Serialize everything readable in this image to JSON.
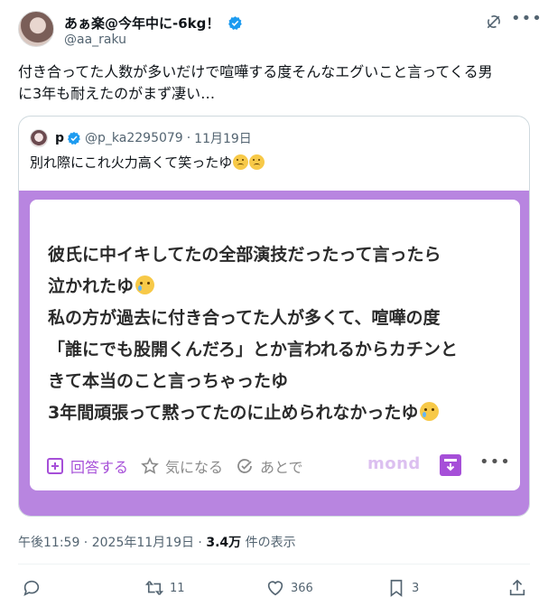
{
  "user": {
    "display_name": "あぁ楽@今年中に-6kg！",
    "handle": "@aa_raku"
  },
  "icons": {
    "verified": "verified-badge-icon",
    "grok": "grok-icon",
    "more": "more-icon"
  },
  "tweet": {
    "text_line1": "付き合ってた人数が多いだけで喧嘩する度そんなエグいこと言ってくる男",
    "text_line2": "に3年も耐えたのがまず凄い…"
  },
  "quote": {
    "display_name": "p",
    "handle": "@p_ka2295079",
    "separator": "·",
    "date": "11月19日",
    "text": "別れ際にこれ火力高くて笑ったゆ",
    "card": {
      "lines": [
        "彼氏に中イキしてたの全部演技だったって言ったら",
        "泣かれたゆ",
        "私の方が過去に付き合ってた人が多くて、喧嘩の度",
        "「誰にでも股開くんだろ」とか言われるからカチンと",
        "きて本当のこと言っちゃったゆ",
        "3年間頑張って黙ってたのに止められなかったゆ"
      ],
      "answer_label": "回答する",
      "interest_label": "気になる",
      "later_label": "あとで",
      "brand": "mond",
      "accent_color": "#b885e0"
    }
  },
  "meta": {
    "time": "午後11:59",
    "separator1": " · ",
    "date": "2025年11月19日",
    "separator2": " · ",
    "views": "3.4万",
    "views_label": " 件の表示"
  },
  "actions": {
    "reply_count": "",
    "retweet_count": "11",
    "like_count": "366",
    "bookmark_count": "3"
  }
}
